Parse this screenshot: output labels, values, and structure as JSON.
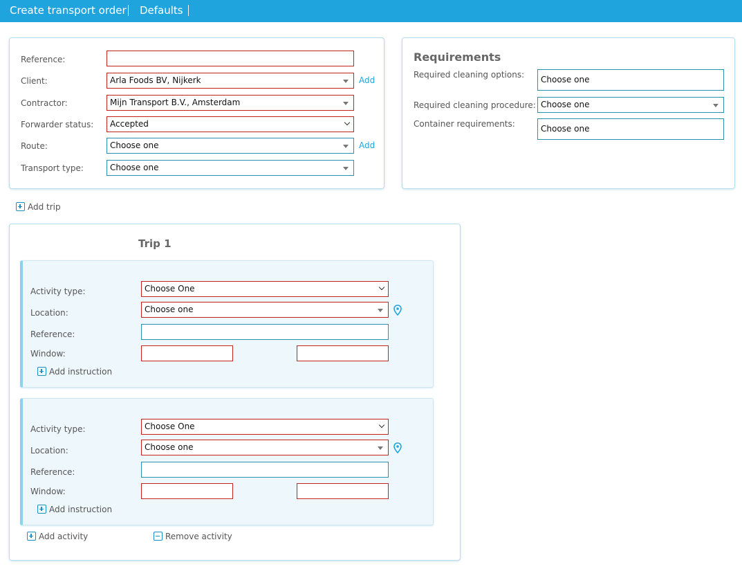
{
  "header": {
    "tabs": [
      {
        "label": "Create transport order"
      },
      {
        "label": "Defaults"
      }
    ]
  },
  "order": {
    "reference_label": "Reference:",
    "reference_value": "",
    "client_label": "Client:",
    "client_value": "Arla Foods BV, Nijkerk",
    "client_add": "Add",
    "contractor_label": "Contractor:",
    "contractor_value": "Mijn Transport B.V., Amsterdam",
    "forwarder_label": "Forwarder status:",
    "forwarder_value": "Accepted",
    "route_label": "Route:",
    "route_value": "Choose one",
    "route_add": "Add",
    "transport_label": "Transport type:",
    "transport_value": "Choose one"
  },
  "requirements": {
    "title": "Requirements",
    "cleaning_options_label": "Required cleaning options:",
    "cleaning_options_value": "Choose one",
    "cleaning_procedure_label": "Required cleaning procedure:",
    "cleaning_procedure_value": "Choose one",
    "container_label": "Container requirements:",
    "container_value": "Choose one"
  },
  "add_trip": "Add trip",
  "trip": {
    "title": "Trip 1",
    "activities": [
      {
        "activity_type_label": "Activity type:",
        "activity_type_value": "Choose One",
        "location_label": "Location:",
        "location_value": "Choose one",
        "reference_label": "Reference:",
        "reference_value": "",
        "window_label": "Window:",
        "window_start": "",
        "window_end": "",
        "add_instruction": "Add instruction"
      },
      {
        "activity_type_label": "Activity type:",
        "activity_type_value": "Choose One",
        "location_label": "Location:",
        "location_value": "Choose one",
        "reference_label": "Reference:",
        "reference_value": "",
        "window_label": "Window:",
        "window_start": "",
        "window_end": "",
        "add_instruction": "Add instruction"
      }
    ],
    "add_activity": "Add activity",
    "remove_activity": "Remove activity"
  },
  "colors": {
    "header_bg": "#1fa4dd",
    "error_border": "#c2231d",
    "valid_border": "#2a8fb5",
    "link": "#1fa4dd"
  }
}
